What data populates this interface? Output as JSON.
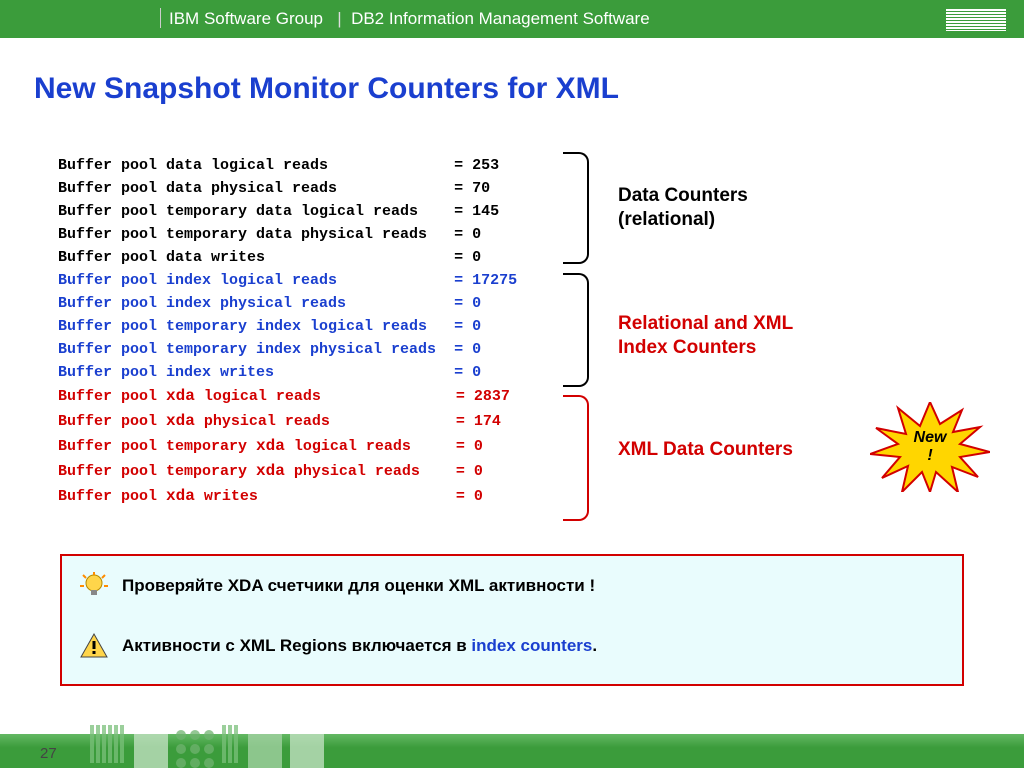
{
  "header": {
    "group": "IBM Software Group",
    "product": "DB2 Information Management Software"
  },
  "title": "New Snapshot Monitor Counters for XML",
  "counters": {
    "data": [
      {
        "label": "Buffer pool data logical reads",
        "value": "253"
      },
      {
        "label": "Buffer pool data physical reads",
        "value": "70"
      },
      {
        "label": "Buffer pool temporary data logical reads",
        "value": "145"
      },
      {
        "label": "Buffer pool temporary data physical reads",
        "value": "0"
      },
      {
        "label": "Buffer pool data writes",
        "value": "0"
      }
    ],
    "index": [
      {
        "label": "Buffer pool index logical reads",
        "value": "17275"
      },
      {
        "label": "Buffer pool index physical reads",
        "value": "0"
      },
      {
        "label": "Buffer pool temporary index logical reads",
        "value": "0"
      },
      {
        "label": "Buffer pool temporary index physical reads",
        "value": "0"
      },
      {
        "label": "Buffer pool index writes",
        "value": "0"
      }
    ],
    "xda": [
      {
        "pre": "Buffer pool ",
        "kw": "xda",
        "post": " logical reads",
        "value": "2837"
      },
      {
        "pre": "Buffer pool ",
        "kw": "xda",
        "post": " physical reads",
        "value": "174"
      },
      {
        "pre": "Buffer pool temporary ",
        "kw": "xda",
        "post": " logical reads",
        "value": "0"
      },
      {
        "pre": "Buffer pool temporary ",
        "kw": "xda",
        "post": " physical reads",
        "value": "0"
      },
      {
        "pre": "Buffer pool ",
        "kw": "xda",
        "post": " writes",
        "value": "0"
      }
    ]
  },
  "annotations": {
    "data": "Data Counters (relational)",
    "index": "Relational and XML Index Counters",
    "xda": "XML Data Counters",
    "star": "New\n!"
  },
  "callout": {
    "line1": "Проверяйте XDA счетчики для оценки XML активности !",
    "line2a": "Активности с XML Regions включается в  ",
    "line2b": "index counters",
    "line2c": "."
  },
  "page": "27"
}
